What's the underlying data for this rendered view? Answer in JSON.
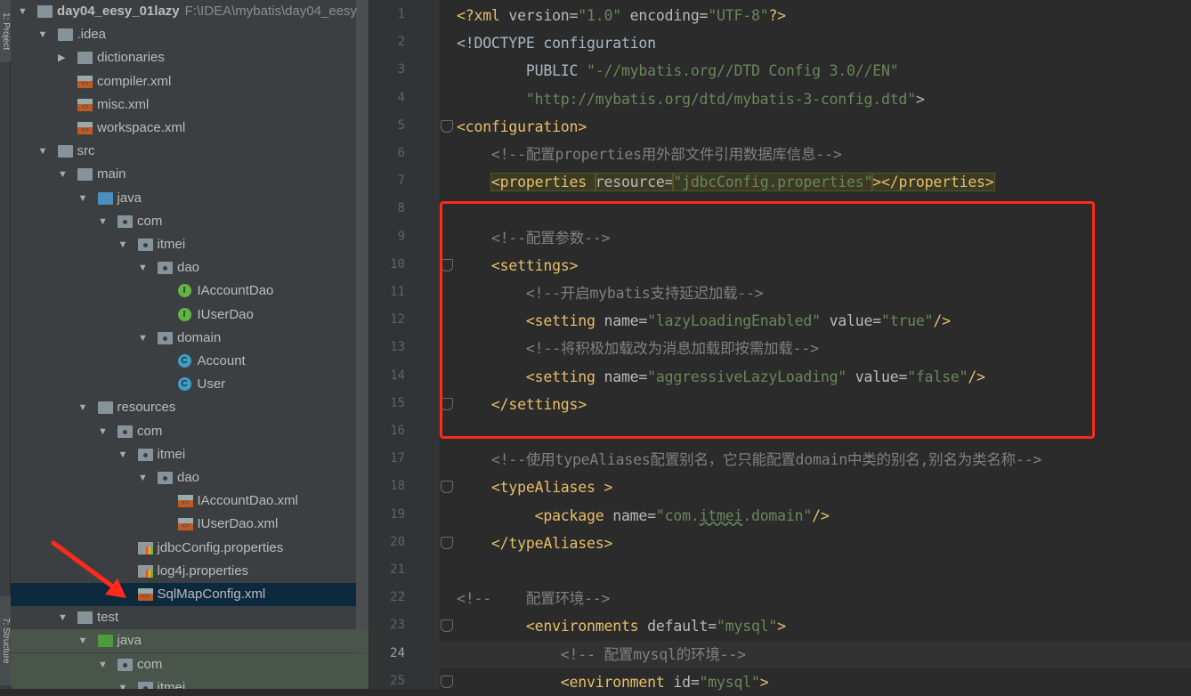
{
  "sidebar_tabs": {
    "project": "1: Project",
    "structure": "7: Structure"
  },
  "tree": [
    {
      "label": "day04_eesy_01lazy",
      "path": "F:\\IDEA\\mybatis\\day04_eesy",
      "depth": 0,
      "arrow": "down",
      "icon": "module-folder",
      "bold": true
    },
    {
      "label": ".idea",
      "depth": 1,
      "arrow": "down",
      "icon": "folder"
    },
    {
      "label": "dictionaries",
      "depth": 2,
      "arrow": "right",
      "icon": "folder"
    },
    {
      "label": "compiler.xml",
      "depth": 2,
      "icon": "xml"
    },
    {
      "label": "misc.xml",
      "depth": 2,
      "icon": "xml"
    },
    {
      "label": "workspace.xml",
      "depth": 2,
      "icon": "xml"
    },
    {
      "label": "src",
      "depth": 1,
      "arrow": "down",
      "icon": "folder"
    },
    {
      "label": "main",
      "depth": 2,
      "arrow": "down",
      "icon": "folder"
    },
    {
      "label": "java",
      "depth": 3,
      "arrow": "down",
      "icon": "source-folder"
    },
    {
      "label": "com",
      "depth": 4,
      "arrow": "down",
      "icon": "package"
    },
    {
      "label": "itmei",
      "depth": 5,
      "arrow": "down",
      "icon": "package"
    },
    {
      "label": "dao",
      "depth": 6,
      "arrow": "down",
      "icon": "package"
    },
    {
      "label": "IAccountDao",
      "depth": 7,
      "icon": "interface"
    },
    {
      "label": "IUserDao",
      "depth": 7,
      "icon": "interface"
    },
    {
      "label": "domain",
      "depth": 6,
      "arrow": "down",
      "icon": "package"
    },
    {
      "label": "Account",
      "depth": 7,
      "icon": "class"
    },
    {
      "label": "User",
      "depth": 7,
      "icon": "class"
    },
    {
      "label": "resources",
      "depth": 3,
      "arrow": "down",
      "icon": "resources-folder"
    },
    {
      "label": "com",
      "depth": 4,
      "arrow": "down",
      "icon": "package"
    },
    {
      "label": "itmei",
      "depth": 5,
      "arrow": "down",
      "icon": "package"
    },
    {
      "label": "dao",
      "depth": 6,
      "arrow": "down",
      "icon": "package"
    },
    {
      "label": "IAccountDao.xml",
      "depth": 7,
      "icon": "xml"
    },
    {
      "label": "IUserDao.xml",
      "depth": 7,
      "icon": "xml"
    },
    {
      "label": "jdbcConfig.properties",
      "depth": 5,
      "icon": "properties"
    },
    {
      "label": "log4j.properties",
      "depth": 5,
      "icon": "properties"
    },
    {
      "label": "SqlMapConfig.xml",
      "depth": 5,
      "icon": "xml",
      "selected": true
    },
    {
      "label": "test",
      "depth": 2,
      "arrow": "down",
      "icon": "folder"
    },
    {
      "label": "java",
      "depth": 3,
      "arrow": "down",
      "icon": "test-folder",
      "test": true
    },
    {
      "label": "com",
      "depth": 4,
      "arrow": "down",
      "icon": "package",
      "test": true
    },
    {
      "label": "itmei",
      "depth": 5,
      "arrow": "down",
      "icon": "package",
      "test": true
    }
  ],
  "editor": {
    "current_line": 24,
    "lines": [
      [
        [
          "pi",
          "<?xml "
        ],
        [
          "attr",
          "version="
        ],
        [
          "val",
          "\"1.0\""
        ],
        [
          "attr",
          " encoding="
        ],
        [
          "val",
          "\"UTF-8\""
        ],
        [
          "pi",
          "?>"
        ]
      ],
      [
        [
          "plain",
          "<!DOCTYPE configuration"
        ]
      ],
      [
        [
          "plain",
          "        PUBLIC "
        ],
        [
          "val",
          "\"-//mybatis.org//DTD Config 3.0//EN\""
        ]
      ],
      [
        [
          "val",
          "        \"http://mybatis.org/dtd/mybatis-3-config.dtd\""
        ],
        [
          "plain",
          ">"
        ]
      ],
      [
        [
          "tag",
          "<configuration>"
        ]
      ],
      [
        [
          "com",
          "    <!--配置properties用外部文件引用数据库信息-->"
        ]
      ],
      [
        [
          "plain",
          "    "
        ],
        [
          "tag hl",
          "<properties "
        ],
        [
          "attr hl",
          "resource="
        ],
        [
          "val hl",
          "\"jdbcConfig.properties\""
        ],
        [
          "tag hl",
          "></properties>"
        ]
      ],
      [],
      [
        [
          "com",
          "    <!--配置参数-->"
        ]
      ],
      [
        [
          "tag",
          "    <settings>"
        ]
      ],
      [
        [
          "com",
          "        <!--开启mybatis支持延迟加载-->"
        ]
      ],
      [
        [
          "tag",
          "        <setting "
        ],
        [
          "attr",
          "name="
        ],
        [
          "val",
          "\"lazyLoadingEnabled\""
        ],
        [
          "attr",
          " value="
        ],
        [
          "val",
          "\"true\""
        ],
        [
          "tag",
          "/>"
        ]
      ],
      [
        [
          "com",
          "        <!--将积极加载改为消息加载即按需加载-->"
        ]
      ],
      [
        [
          "tag",
          "        <setting "
        ],
        [
          "attr",
          "name="
        ],
        [
          "val",
          "\"aggressiveLazyLoading\""
        ],
        [
          "attr",
          " value="
        ],
        [
          "val",
          "\"false\""
        ],
        [
          "tag",
          "/>"
        ]
      ],
      [
        [
          "tag",
          "    </settings>"
        ]
      ],
      [],
      [
        [
          "com",
          "    <!--使用typeAliases配置别名，它只能配置domain中类的别名,别名为类名称-->"
        ]
      ],
      [
        [
          "tag",
          "    <typeAliases >"
        ]
      ],
      [
        [
          "tag",
          "         <package "
        ],
        [
          "attr",
          "name="
        ],
        [
          "val",
          "\"com."
        ],
        [
          "val under",
          "itmei"
        ],
        [
          "val",
          ".domain\""
        ],
        [
          "tag",
          "/>"
        ]
      ],
      [
        [
          "tag",
          "    </typeAliases>"
        ]
      ],
      [],
      [
        [
          "com",
          "<!--    配置环境-->"
        ]
      ],
      [
        [
          "tag",
          "        <environments "
        ],
        [
          "attr",
          "default="
        ],
        [
          "val",
          "\"mysql\""
        ],
        [
          "tag",
          ">"
        ]
      ],
      [
        [
          "com",
          "            <!-- 配置mysql的环境-->"
        ]
      ],
      [
        [
          "tag",
          "            <environment "
        ],
        [
          "attr",
          "id="
        ],
        [
          "val",
          "\"mysql\""
        ],
        [
          "tag",
          ">"
        ]
      ]
    ],
    "fold_lines": [
      5,
      10,
      15,
      18,
      20,
      23,
      25
    ]
  },
  "colors": {
    "annotation": "#ff2a1a",
    "tag": "#e8bf6a",
    "value": "#6a8759",
    "comment": "#808080"
  }
}
